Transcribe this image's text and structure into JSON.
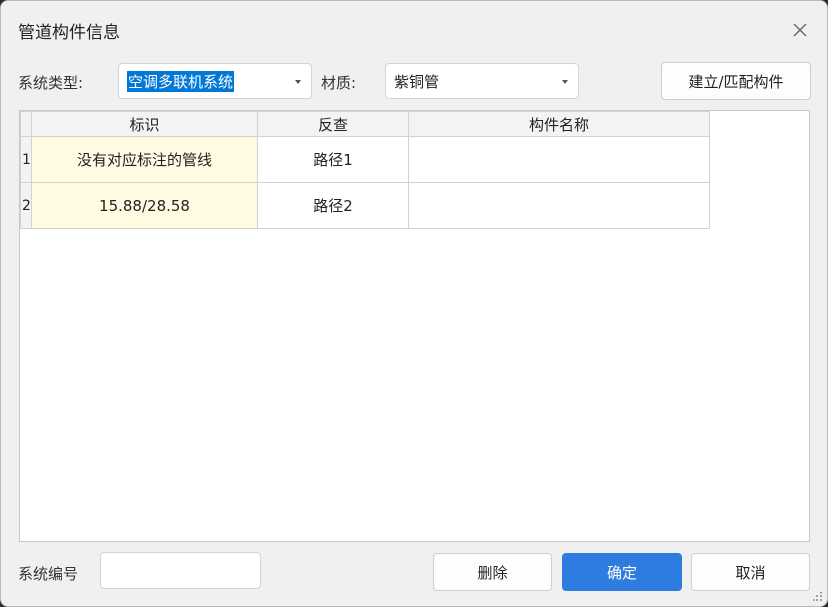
{
  "dialog": {
    "title": "管道构件信息"
  },
  "toolbar": {
    "system_type_label": "系统类型:",
    "system_type_value": "空调多联机系统",
    "material_label": "材质:",
    "material_value": "紫铜管",
    "build_match_label": "建立/匹配构件"
  },
  "grid": {
    "columns": [
      "标识",
      "反查",
      "构件名称"
    ],
    "rows": [
      {
        "num": "1",
        "ident": "没有对应标注的管线",
        "lookup": "路径1",
        "name": ""
      },
      {
        "num": "2",
        "ident": "15.88/28.58",
        "lookup": "路径2",
        "name": ""
      }
    ]
  },
  "footer": {
    "system_no_label": "系统编号",
    "system_no_value": "",
    "delete_label": "删除",
    "ok_label": "确定",
    "cancel_label": "取消"
  },
  "colors": {
    "primary": "#2f7ce0",
    "selection": "#0078d7",
    "ident_cell": "#fffbe3"
  }
}
